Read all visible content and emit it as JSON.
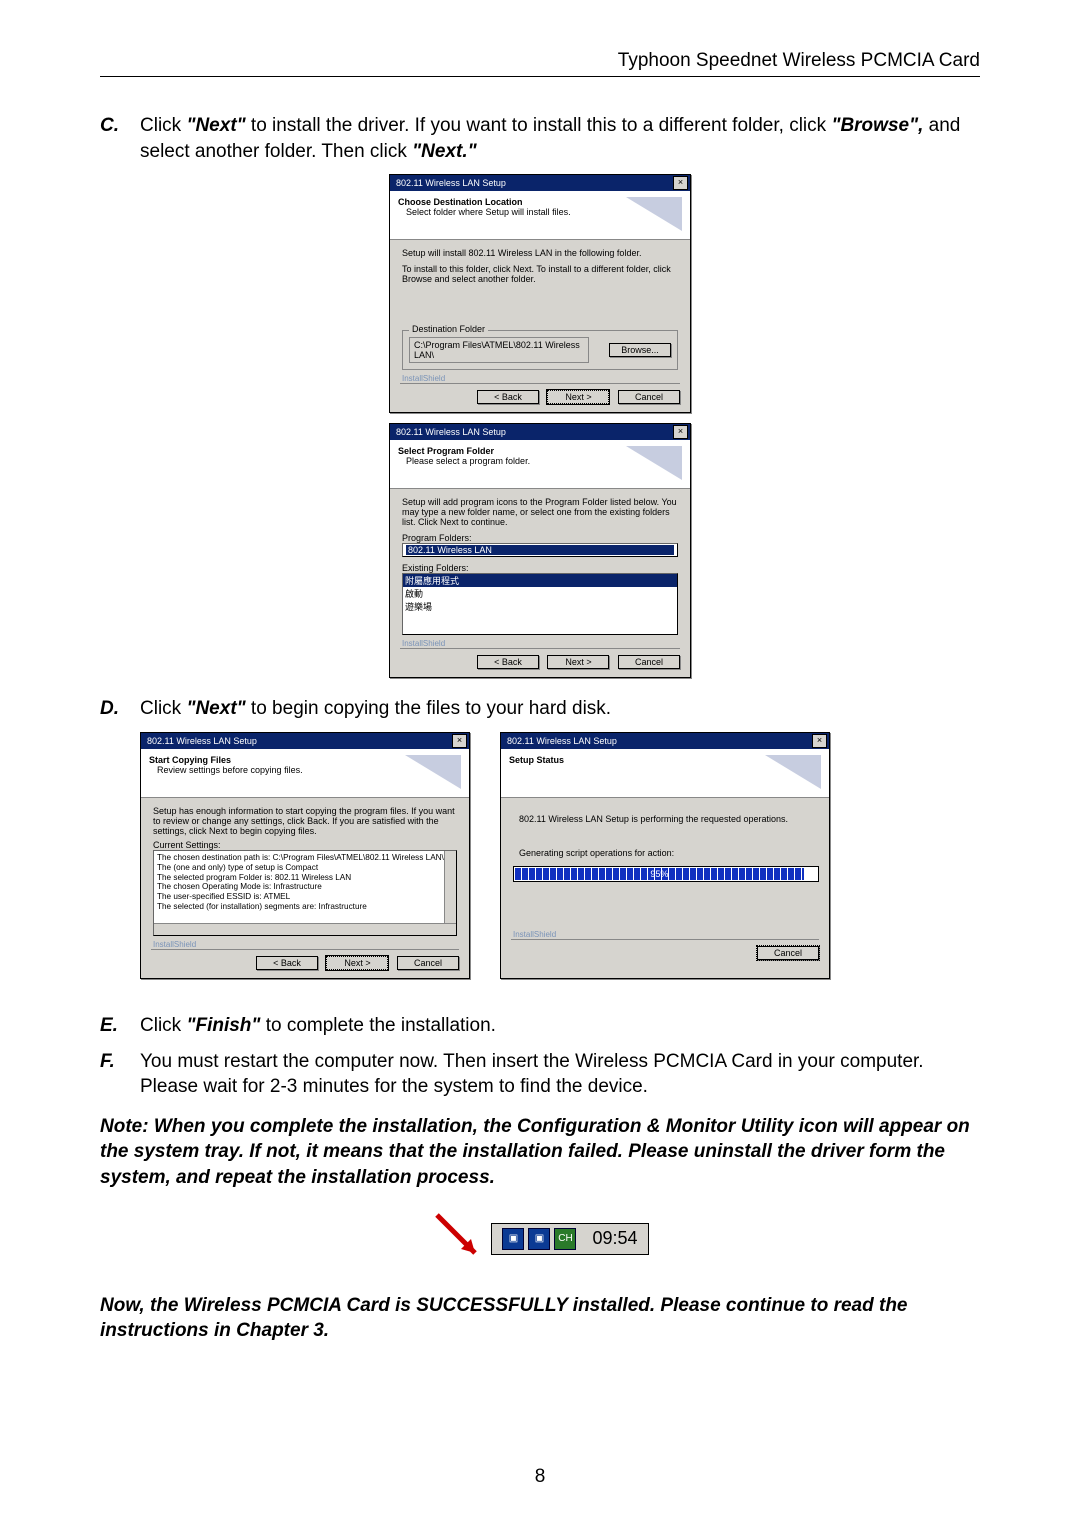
{
  "header": {
    "product": "Typhoon Speednet Wireless PCMCIA Card"
  },
  "page_number": "8",
  "steps": {
    "c": {
      "letter": "C.",
      "pre": "Click ",
      "q1": "\"Next\"",
      "mid": " to install the driver. If you want to install this to a different folder, click ",
      "q2": "\"Browse\",",
      "mid2": " and select another folder. Then click ",
      "q3": "\"Next.\""
    },
    "d": {
      "letter": "D.",
      "text_pre": "Click ",
      "q": "\"Next\"",
      "text_post": " to begin copying the files to your hard disk."
    },
    "e": {
      "letter": "E.",
      "text_pre": "Click ",
      "q": "\"Finish\"",
      "text_post": " to complete the installation."
    },
    "f": {
      "letter": "F.",
      "text": "You must restart the computer now. Then insert the Wireless PCMCIA Card in your computer. Please wait for 2-3 minutes for the system to find the device."
    }
  },
  "note": "Note: When you complete the installation, the Configuration & Monitor Utility icon will appear on the system tray. If not, it means that the installation failed. Please uninstall the driver form the system, and repeat the installation process.",
  "note2": "Now, the Wireless PCMCIA Card is SUCCESSFULLY installed. Please continue to read the instructions in Chapter 3.",
  "tray": {
    "icon1": "▣",
    "icon2": "▣",
    "icon3": "CH",
    "time": "09:54"
  },
  "dlg1": {
    "title": "802.11 Wireless LAN Setup",
    "h": "Choose Destination Location",
    "sub": "Select folder where Setup will install files.",
    "l1": "Setup will install 802.11 Wireless LAN in the following folder.",
    "l2": "To install to this folder, click Next. To install to a different folder, click Browse and select another folder.",
    "legend": "Destination Folder",
    "path": "C:\\Program Files\\ATMEL\\802.11 Wireless LAN\\",
    "browse": "Browse...",
    "brand": "InstallShield",
    "back": "< Back",
    "next": "Next >",
    "cancel": "Cancel"
  },
  "dlg2": {
    "title": "802.11 Wireless LAN Setup",
    "h": "Select Program Folder",
    "sub": "Please select a program folder.",
    "l1": "Setup will add program icons to the Program Folder listed below. You may type a new folder name, or select one from the existing folders list. Click Next to continue.",
    "pf_label": "Program Folders:",
    "pf_value": "802.11 Wireless LAN",
    "ef_label": "Existing Folders:",
    "ef_sel": "附屬應用程式",
    "ef2": "啟動",
    "ef3": "遊樂場",
    "brand": "InstallShield",
    "back": "< Back",
    "next": "Next >",
    "cancel": "Cancel"
  },
  "dlg3": {
    "title": "802.11 Wireless LAN Setup",
    "h": "Start Copying Files",
    "sub": "Review settings before copying files.",
    "l1": "Setup has enough information to start copying the program files. If you want to review or change any settings, click Back. If you are satisfied with the settings, click Next to begin copying files.",
    "cs": "Current Settings:",
    "s1": "The chosen destination path is: C:\\Program Files\\ATMEL\\802.11 Wireless LAN\\",
    "s2": "The (one and only) type of setup is Compact",
    "s3": "The selected program Folder is: 802.11 Wireless LAN",
    "s4": "The chosen Operating Mode is: Infrastructure",
    "s5": "The user-specified ESSID is:  ATMEL",
    "s6": "The selected (for installation) segments are: Infrastructure",
    "brand": "InstallShield",
    "back": "< Back",
    "next": "Next >",
    "cancel": "Cancel"
  },
  "dlg4": {
    "title": "802.11 Wireless LAN Setup",
    "h": "Setup Status",
    "l1": "802.11 Wireless LAN Setup is performing the requested operations.",
    "l2": "Generating script operations for action:",
    "pct": "95%",
    "brand": "InstallShield",
    "cancel": "Cancel"
  },
  "chart_data": {
    "type": "bar",
    "title": "Setup Status progress",
    "categories": [
      "progress"
    ],
    "values": [
      95
    ],
    "ylim": [
      0,
      100
    ],
    "xlabel": "",
    "ylabel": "%"
  }
}
